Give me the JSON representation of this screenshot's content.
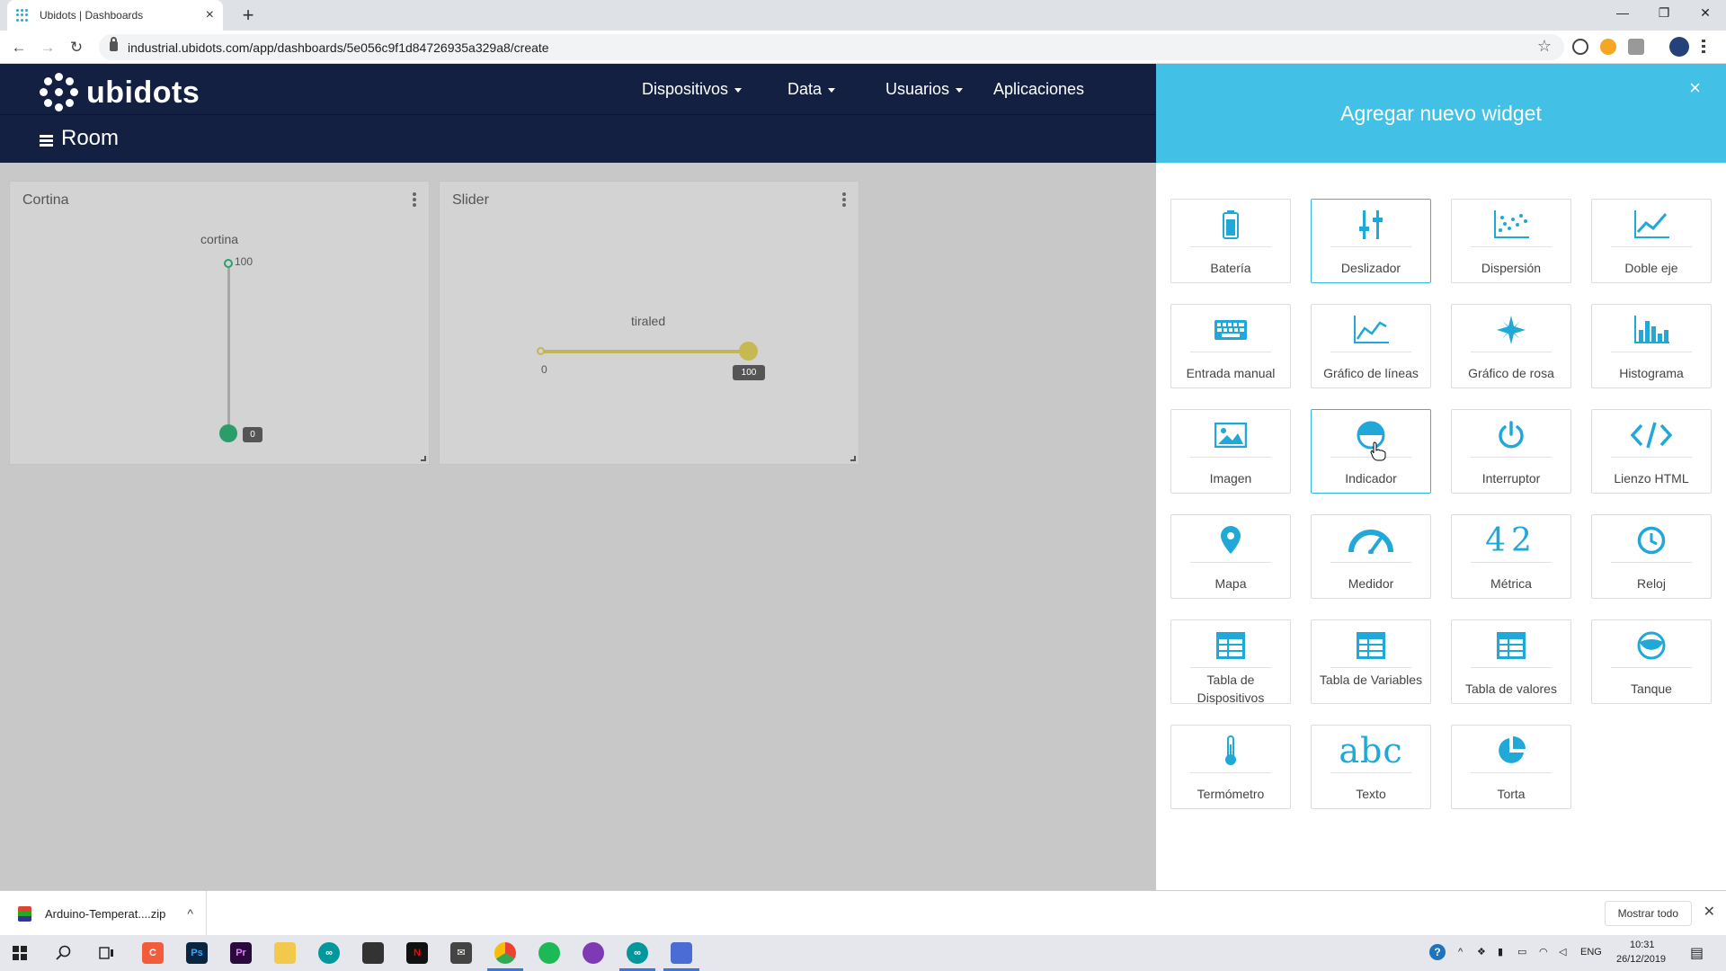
{
  "browser": {
    "tab_title": "Ubidots | Dashboards",
    "url": "industrial.ubidots.com/app/dashboards/5e056c9f1d84726935a329a8/create"
  },
  "app": {
    "logo_text": "ubidots",
    "nav": [
      {
        "label": "Dispositivos",
        "dropdown": true
      },
      {
        "label": "Data",
        "dropdown": true
      },
      {
        "label": "Usuarios",
        "dropdown": true
      },
      {
        "label": "Aplicaciones",
        "dropdown": false
      }
    ],
    "dashboard_title": "Room"
  },
  "widgets": [
    {
      "title": "Cortina",
      "type": "vertical-slider",
      "variable_label": "cortina",
      "max_label": "100",
      "value_label": "0",
      "value": 0,
      "color": "#2a9d6a"
    },
    {
      "title": "Slider",
      "type": "horizontal-slider",
      "variable_label": "tiraled",
      "min_label": "0",
      "value_label": "100",
      "value": 100,
      "color": "#c6b952"
    }
  ],
  "panel": {
    "title": "Agregar nuevo widget",
    "accent": "#42c0e5",
    "items": [
      {
        "label": "Batería",
        "icon": "battery-icon",
        "active": false
      },
      {
        "label": "Deslizador",
        "icon": "slider-icon",
        "active": true
      },
      {
        "label": "Dispersión",
        "icon": "scatter-icon",
        "active": false
      },
      {
        "label": "Doble eje",
        "icon": "double-axis-icon",
        "active": false
      },
      {
        "label": "Entrada manual",
        "icon": "keyboard-icon",
        "active": false
      },
      {
        "label": "Gráfico de líneas",
        "icon": "line-chart-icon",
        "active": false
      },
      {
        "label": "Gráfico de rosa",
        "icon": "rose-chart-icon",
        "active": false
      },
      {
        "label": "Histograma",
        "icon": "histogram-icon",
        "active": false
      },
      {
        "label": "Imagen",
        "icon": "image-icon",
        "active": false
      },
      {
        "label": "Indicador",
        "icon": "indicator-icon",
        "active": true
      },
      {
        "label": "Interruptor",
        "icon": "power-icon",
        "active": false
      },
      {
        "label": "Lienzo HTML",
        "icon": "code-icon",
        "active": false
      },
      {
        "label": "Mapa",
        "icon": "map-pin-icon",
        "active": false
      },
      {
        "label": "Medidor",
        "icon": "gauge-icon",
        "active": false
      },
      {
        "label": "Métrica",
        "icon": "metric-icon",
        "text_icon": "42",
        "active": false
      },
      {
        "label": "Reloj",
        "icon": "clock-icon",
        "active": false
      },
      {
        "label": "Tabla de Dispositivos",
        "icon": "table-icon",
        "active": false
      },
      {
        "label": "Tabla de Variables",
        "icon": "table-icon",
        "active": false
      },
      {
        "label": "Tabla de valores",
        "icon": "table-icon",
        "active": false
      },
      {
        "label": "Tanque",
        "icon": "tank-icon",
        "active": false
      },
      {
        "label": "Termómetro",
        "icon": "thermometer-icon",
        "active": false
      },
      {
        "label": "Texto",
        "icon": "text-icon",
        "text_icon": "abc",
        "active": false
      },
      {
        "label": "Torta",
        "icon": "pie-icon",
        "active": false
      }
    ]
  },
  "download_bar": {
    "file_name": "Arduino-Temperat....zip",
    "show_all": "Mostrar todo"
  },
  "taskbar": {
    "language": "ENG",
    "time": "10:31",
    "date": "26/12/2019"
  }
}
